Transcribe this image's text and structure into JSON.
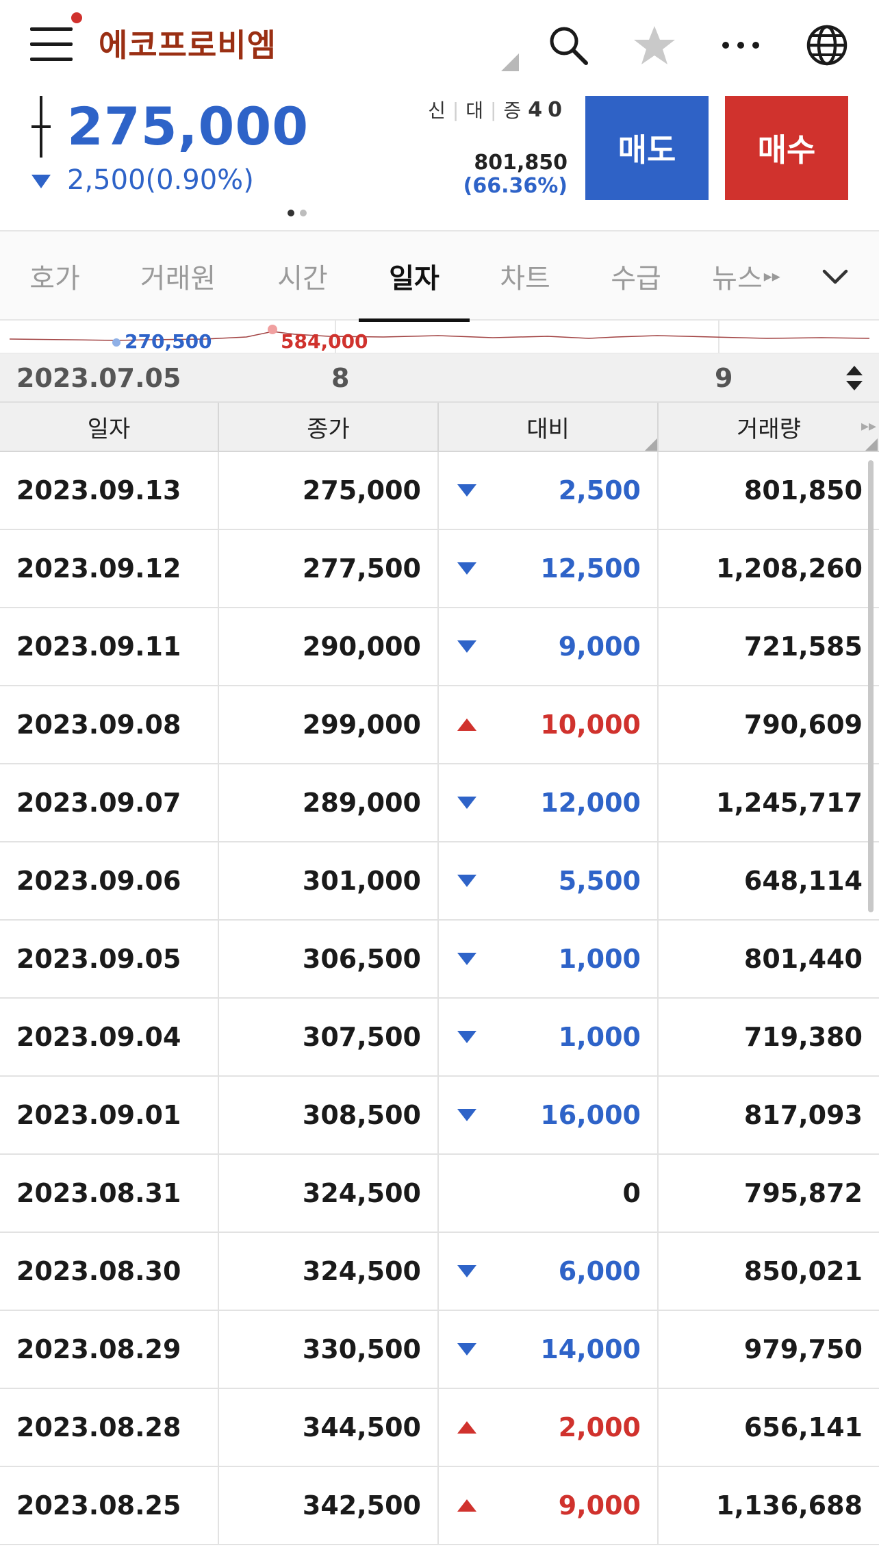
{
  "header": {
    "stock_name": "에코프로비엠"
  },
  "quote": {
    "price": "275,000",
    "change": "2,500(0.90%)",
    "credit_labels": [
      "신",
      "대",
      "증"
    ],
    "credit_value": "40",
    "volume": "801,850",
    "volume_ratio": "(66.36%)",
    "sell_label": "매도",
    "buy_label": "매수"
  },
  "tabs": [
    {
      "label": "호가",
      "active": false
    },
    {
      "label": "거래원",
      "active": false
    },
    {
      "label": "시간",
      "active": false
    },
    {
      "label": "일자",
      "active": true
    },
    {
      "label": "차트",
      "active": false
    },
    {
      "label": "수급",
      "active": false
    },
    {
      "label": "뉴스",
      "active": false
    }
  ],
  "mini_chart": {
    "low": "270,500",
    "high": "584,000"
  },
  "range": {
    "start_date": "2023.07.05",
    "month_1": "8",
    "month_2": "9"
  },
  "table": {
    "headers": [
      "일자",
      "종가",
      "대비",
      "거래량"
    ],
    "rows": [
      {
        "date": "2023.09.13",
        "close": "275,000",
        "diff": "2,500",
        "dir": "down",
        "volume": "801,850"
      },
      {
        "date": "2023.09.12",
        "close": "277,500",
        "diff": "12,500",
        "dir": "down",
        "volume": "1,208,260"
      },
      {
        "date": "2023.09.11",
        "close": "290,000",
        "diff": "9,000",
        "dir": "down",
        "volume": "721,585"
      },
      {
        "date": "2023.09.08",
        "close": "299,000",
        "diff": "10,000",
        "dir": "up",
        "volume": "790,609"
      },
      {
        "date": "2023.09.07",
        "close": "289,000",
        "diff": "12,000",
        "dir": "down",
        "volume": "1,245,717"
      },
      {
        "date": "2023.09.06",
        "close": "301,000",
        "diff": "5,500",
        "dir": "down",
        "volume": "648,114"
      },
      {
        "date": "2023.09.05",
        "close": "306,500",
        "diff": "1,000",
        "dir": "down",
        "volume": "801,440"
      },
      {
        "date": "2023.09.04",
        "close": "307,500",
        "diff": "1,000",
        "dir": "down",
        "volume": "719,380"
      },
      {
        "date": "2023.09.01",
        "close": "308,500",
        "diff": "16,000",
        "dir": "down",
        "volume": "817,093"
      },
      {
        "date": "2023.08.31",
        "close": "324,500",
        "diff": "0",
        "dir": "flat",
        "volume": "795,872"
      },
      {
        "date": "2023.08.30",
        "close": "324,500",
        "diff": "6,000",
        "dir": "down",
        "volume": "850,021"
      },
      {
        "date": "2023.08.29",
        "close": "330,500",
        "diff": "14,000",
        "dir": "down",
        "volume": "979,750"
      },
      {
        "date": "2023.08.28",
        "close": "344,500",
        "diff": "2,000",
        "dir": "up",
        "volume": "656,141"
      },
      {
        "date": "2023.08.25",
        "close": "342,500",
        "diff": "9,000",
        "dir": "up",
        "volume": "1,136,688"
      }
    ]
  },
  "colors": {
    "up": "#d0322d",
    "down": "#2e63c8",
    "stock_name": "#9a2f13"
  },
  "icons": [
    "menu-icon",
    "search-icon",
    "star-icon",
    "more-icon",
    "globe-icon",
    "chevron-down-icon",
    "sort-icon"
  ]
}
